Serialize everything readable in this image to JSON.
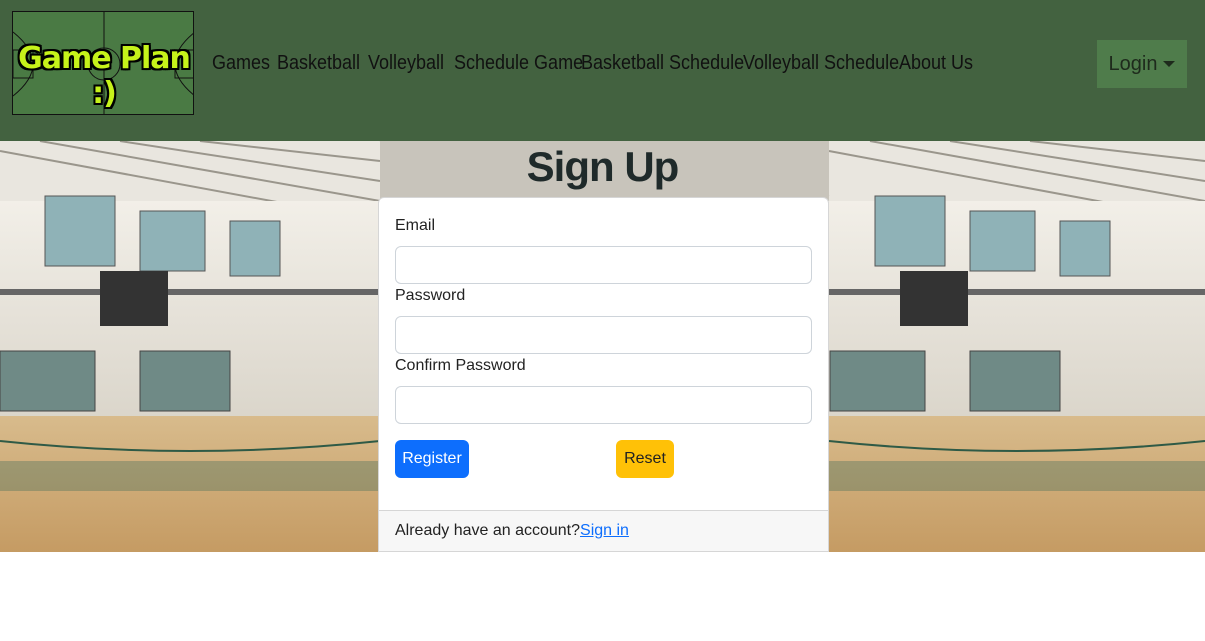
{
  "navbar": {
    "logo_text": "Game Plan :)",
    "links": [
      "Games",
      "Basketball",
      "Volleyball",
      "Schedule Game",
      "Basketball Schedule",
      "Volleyball Schedule",
      "About Us"
    ],
    "login_label": "Login",
    "bg_color": "#436240"
  },
  "page": {
    "title": "Sign Up"
  },
  "form": {
    "email_label": "Email",
    "email_value": "",
    "password_label": "Password",
    "password_value": "",
    "confirm_label": "Confirm Password",
    "confirm_value": "",
    "register_label": "Register",
    "reset_label": "Reset"
  },
  "footer": {
    "prompt": "Already have an account?",
    "link_label": "Sign in"
  },
  "colors": {
    "primary": "#0d6efd",
    "warning": "#ffc107"
  }
}
